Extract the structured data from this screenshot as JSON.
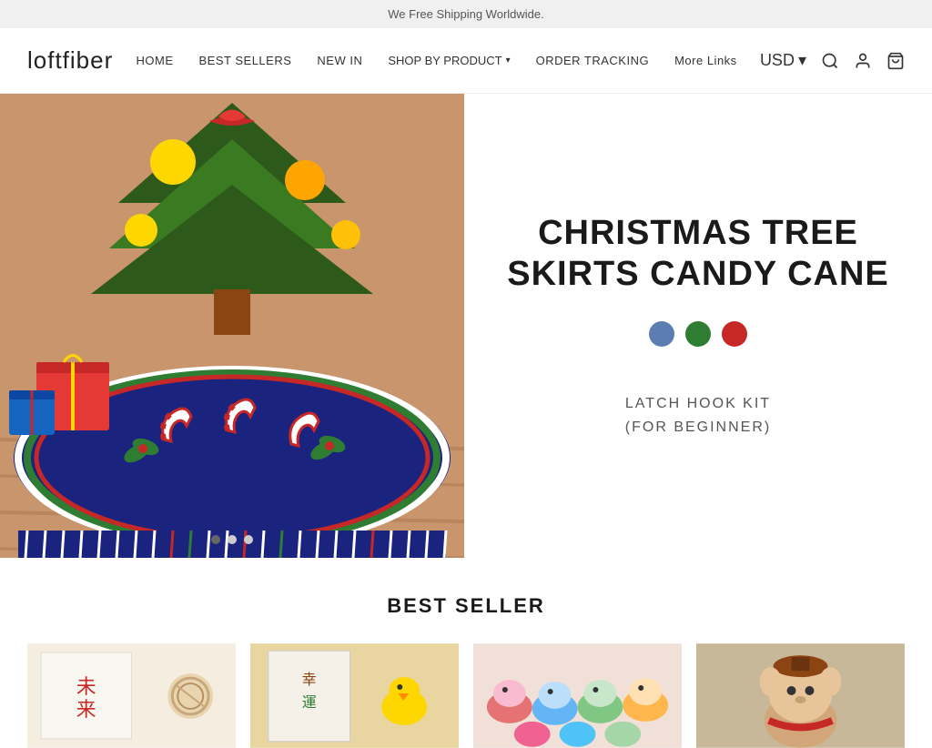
{
  "banner": {
    "text": "We Free Shipping Worldwide."
  },
  "header": {
    "logo": "loftfiber",
    "nav": {
      "items": [
        {
          "label": "HOME",
          "href": "#"
        },
        {
          "label": "BEST SELLERS",
          "href": "#"
        },
        {
          "label": "NEW IN",
          "href": "#"
        },
        {
          "label": "SHOP BY PRODUCT",
          "href": "#",
          "hasDropdown": true
        },
        {
          "label": "ORDER TRACKING",
          "href": "#"
        },
        {
          "label": "More Links",
          "href": "#"
        }
      ]
    },
    "currency": "USD",
    "icons": {
      "search": "🔍",
      "account": "👤",
      "cart": "🛒"
    }
  },
  "hero": {
    "title": "CHRISTMAS TREE SKIRTS CANDY CANE",
    "subtitle_line1": "LATCH HOOK KIT",
    "subtitle_line2": "(FOR BEGINNER)",
    "swatches": [
      {
        "color": "#5b7db1",
        "label": "Blue"
      },
      {
        "color": "#2e7d32",
        "label": "Green"
      },
      {
        "color": "#c62828",
        "label": "Red"
      }
    ],
    "carousel": {
      "dots": [
        {
          "active": true
        },
        {
          "active": false
        },
        {
          "active": false
        }
      ]
    }
  },
  "best_seller": {
    "title": "BEST SELLER",
    "products": [
      {
        "alt": "Japanese art craft product"
      },
      {
        "alt": "Cute plush doll product"
      },
      {
        "alt": "Colorful slippers product"
      },
      {
        "alt": "Brown hat plush product"
      }
    ]
  }
}
